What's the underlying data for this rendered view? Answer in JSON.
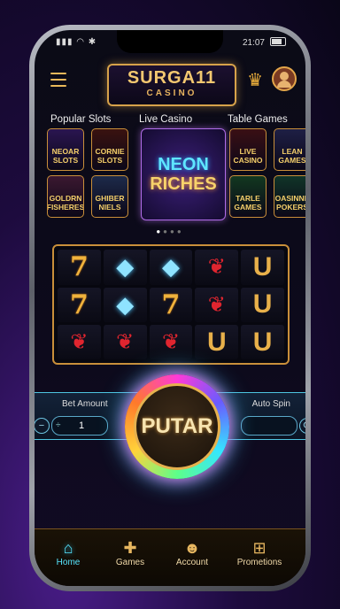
{
  "status": {
    "time": "21:07"
  },
  "brand": {
    "name": "SURGA11",
    "sub": "CASINO"
  },
  "categories": [
    "Popular Slots",
    "Live Casino",
    "Table Games"
  ],
  "tiles_left": [
    {
      "label": "NEOAR SLOTS",
      "bg": "#2a1550"
    },
    {
      "label": "CORNIE SLOTS",
      "bg": "#3a120f"
    },
    {
      "label": "GOLDRN FISHERES",
      "bg": "#3b1830"
    },
    {
      "label": "GHIBER NIELS",
      "bg": "#1d2a4a"
    }
  ],
  "feature": {
    "line1": "NEON",
    "line2": "RICHES"
  },
  "tiles_right": [
    {
      "label": "LIVE CASINO",
      "bg": "#3a0f14"
    },
    {
      "label": "LEAN GAMES",
      "bg": "#1e1f45"
    },
    {
      "label": "TARLE GAMES",
      "bg": "#123820"
    },
    {
      "label": "OASINNE POKERS",
      "bg": "#103428"
    }
  ],
  "reels": [
    [
      "7",
      "diamond",
      "diamond",
      "cherry",
      "horseshoe"
    ],
    [
      "7",
      "diamond",
      "7",
      "cherry",
      "horseshoe"
    ],
    [
      "cherry",
      "cherry",
      "cherry",
      "horseshoe",
      "horseshoe"
    ]
  ],
  "bet": {
    "label": "Bet Amount",
    "value": "1",
    "auto_label": "Auto Spin"
  },
  "spin_label": "PUTAR",
  "nav": [
    {
      "label": "Home",
      "icon": "home-icon",
      "active": true
    },
    {
      "label": "Games",
      "icon": "gamepad-icon",
      "active": false
    },
    {
      "label": "Account",
      "icon": "user-icon",
      "active": false
    },
    {
      "label": "Prometions",
      "icon": "gift-icon",
      "active": false
    }
  ]
}
